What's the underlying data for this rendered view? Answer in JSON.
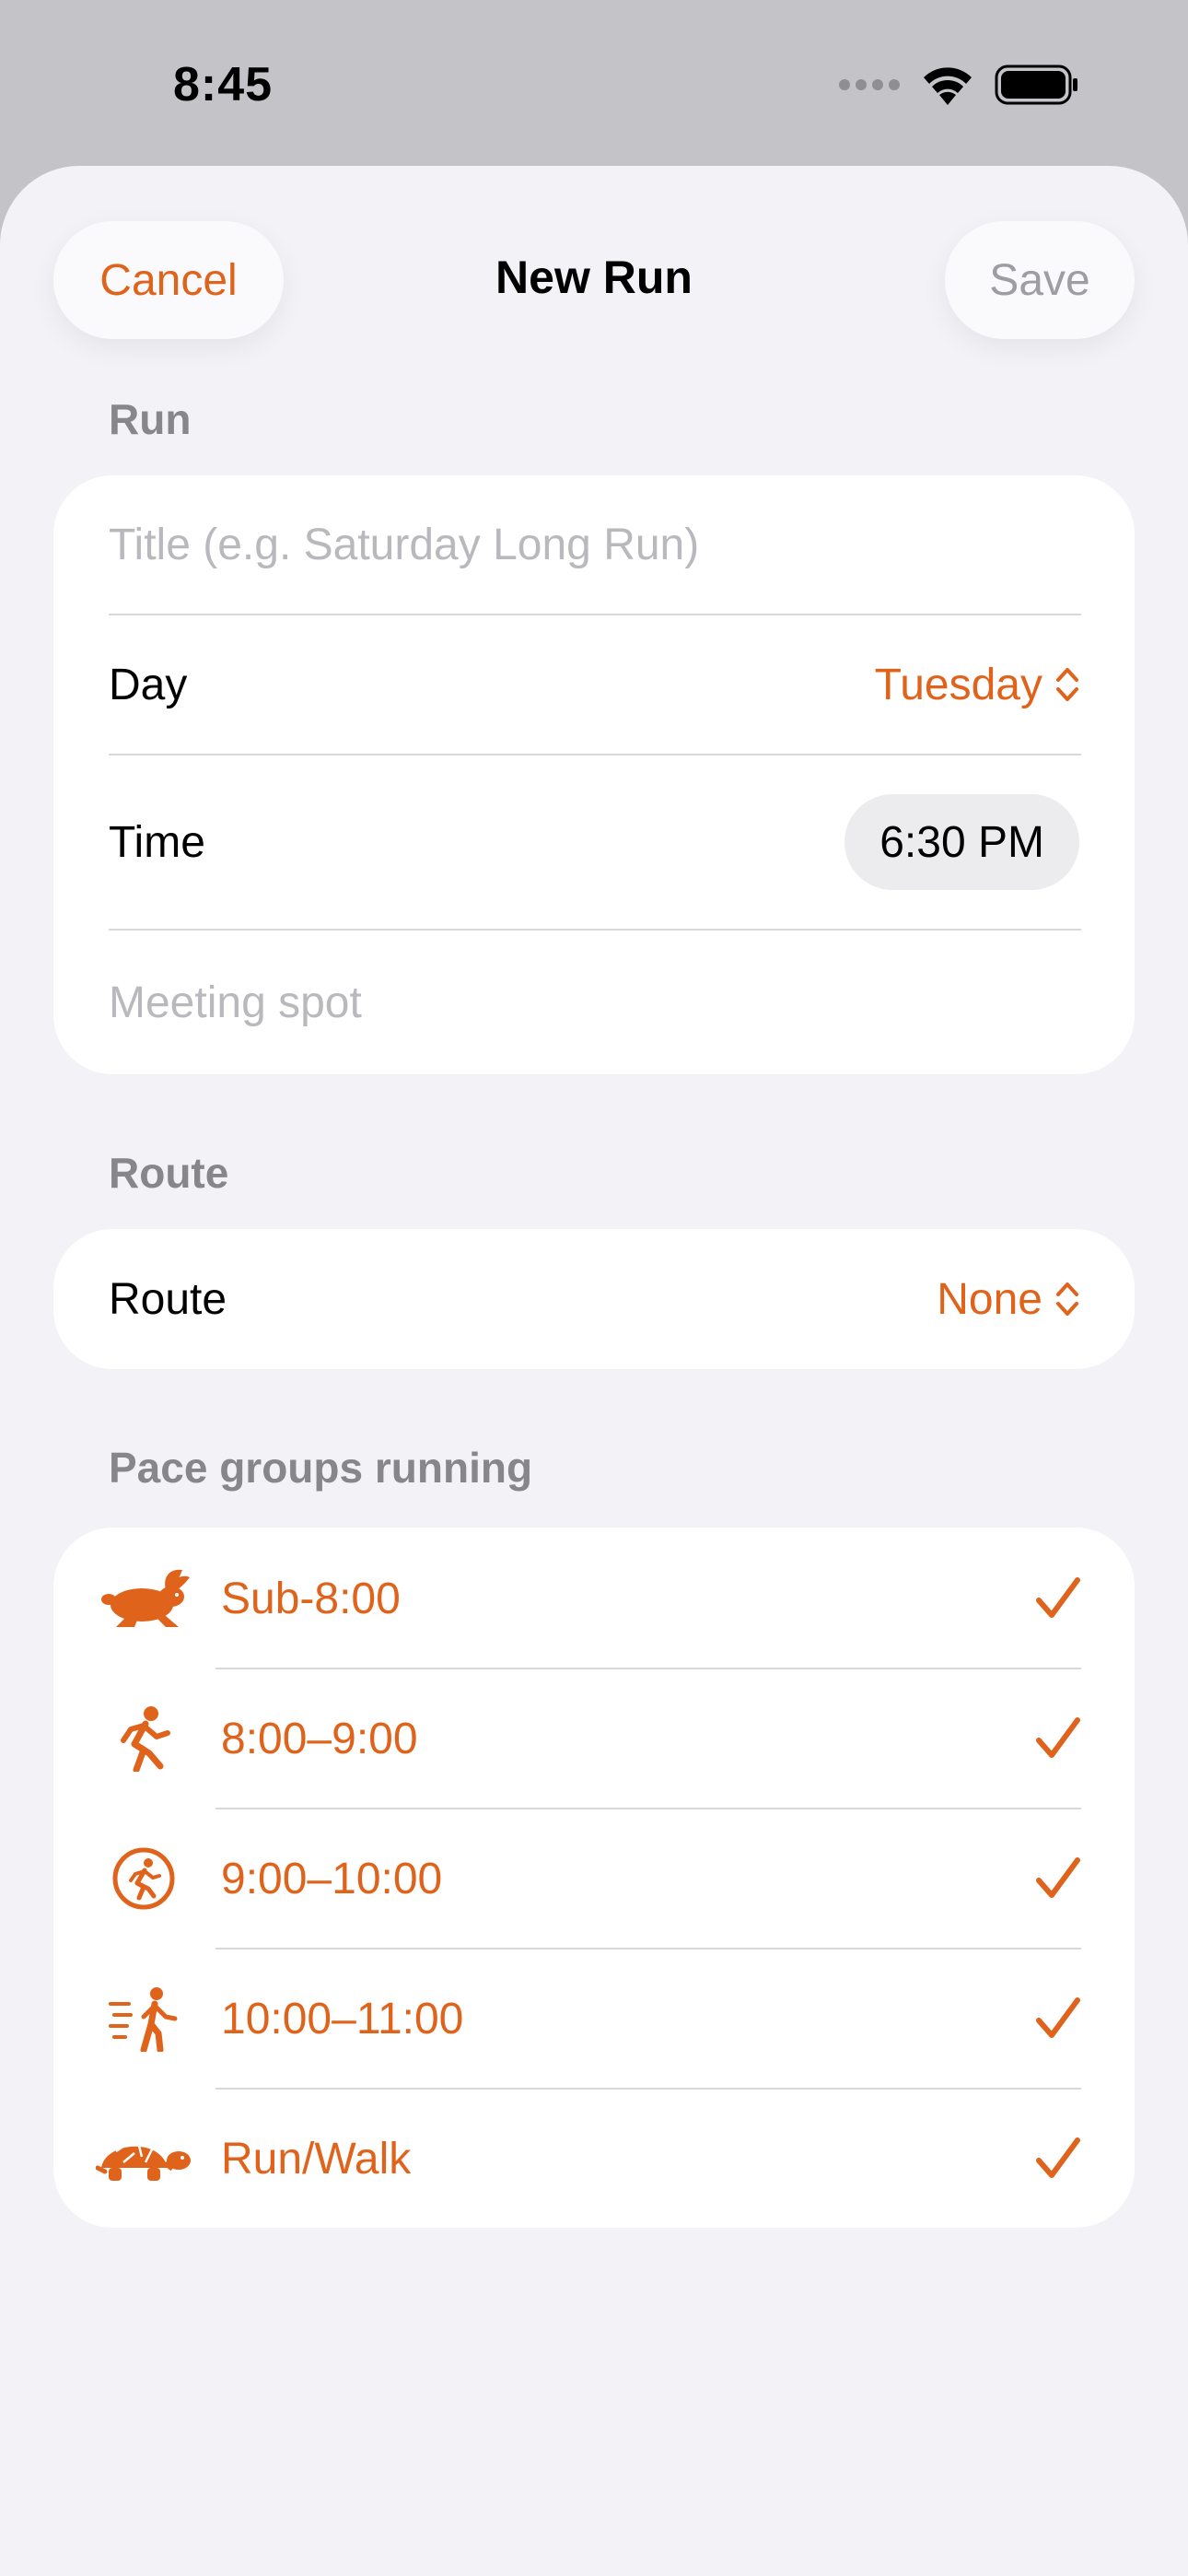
{
  "status_bar": {
    "time": "8:45"
  },
  "nav": {
    "cancel": "Cancel",
    "title": "New Run",
    "save": "Save"
  },
  "run_section": {
    "header": "Run",
    "title_placeholder": "Title (e.g. Saturday Long Run)",
    "day_label": "Day",
    "day_value": "Tuesday",
    "time_label": "Time",
    "time_value": "6:30 PM",
    "meeting_placeholder": "Meeting spot"
  },
  "route_section": {
    "header": "Route",
    "route_label": "Route",
    "route_value": "None"
  },
  "pace_section": {
    "header": "Pace groups running",
    "groups": [
      {
        "icon": "hare-icon",
        "label": "Sub-8:00",
        "checked": true
      },
      {
        "icon": "runner-icon",
        "label": "8:00–9:00",
        "checked": true
      },
      {
        "icon": "runner-circle-icon",
        "label": "9:00–10:00",
        "checked": true
      },
      {
        "icon": "walker-motion-icon",
        "label": "10:00–11:00",
        "checked": true
      },
      {
        "icon": "tortoise-icon",
        "label": "Run/Walk",
        "checked": true
      }
    ]
  },
  "colors": {
    "accent": "#e0631c",
    "background": "#f2f2f7",
    "card": "#ffffff",
    "secondary_text": "#86868b"
  }
}
